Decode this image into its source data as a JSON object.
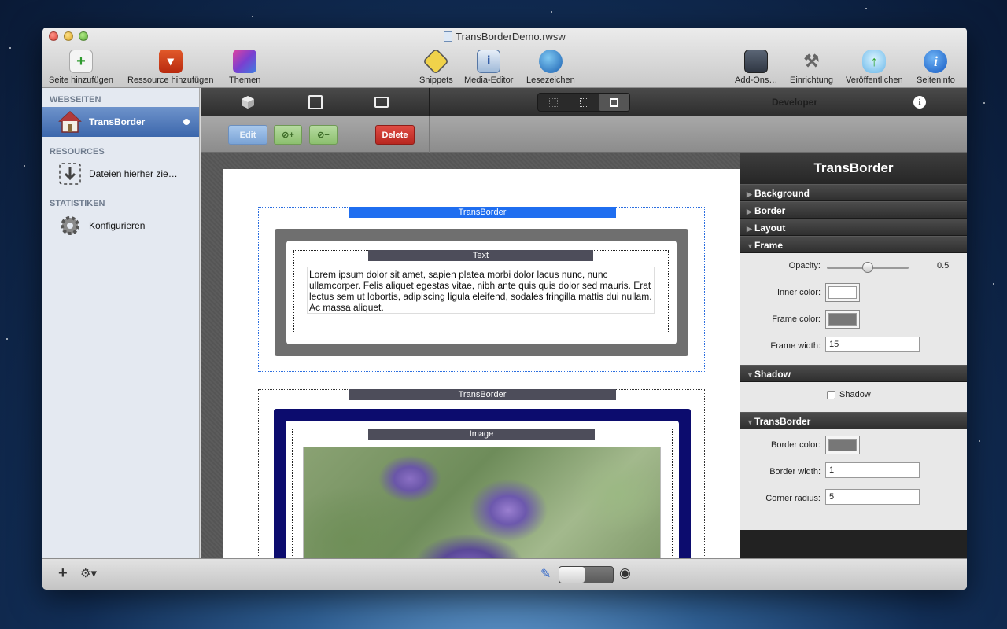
{
  "window": {
    "title": "TransBorderDemo.rwsw"
  },
  "toolbar": {
    "add_page": "Seite hinzufügen",
    "add_resource": "Ressource hinzufügen",
    "themes": "Themen",
    "snippets": "Snippets",
    "media_editor": "Media-Editor",
    "bookmarks": "Lesezeichen",
    "addons": "Add-Ons…",
    "setup": "Einrichtung",
    "publish": "Veröffentlichen",
    "page_info": "Seiteninfo"
  },
  "sidebar": {
    "section_pages": "WEBSEITEN",
    "page_item": "TransBorder",
    "section_resources": "RESOURCES",
    "resource_item": "Dateien hierher zie…",
    "section_stats": "STATISTIKEN",
    "stats_item": "Konfigurieren"
  },
  "editor": {
    "edit_label": "Edit",
    "delete_label": "Delete",
    "stack1_tag": "TransBorder",
    "text_tag": "Text",
    "body_text": "Lorem ipsum dolor sit amet, sapien platea morbi dolor lacus nunc, nunc ullamcorper. Felis aliquet egestas vitae, nibh ante quis quis dolor sed mauris. Erat lectus sem ut lobortis, adipiscing ligula eleifend, sodales fringilla mattis dui nullam. Ac massa aliquet.",
    "stack2_tag": "TransBorder",
    "image_tag": "Image"
  },
  "inspector": {
    "tab_label": "Developer",
    "title": "TransBorder",
    "sections": {
      "background": "Background",
      "border": "Border",
      "layout": "Layout",
      "frame": "Frame",
      "shadow": "Shadow",
      "transborder": "TransBorder"
    },
    "opacity_label": "Opacity:",
    "opacity_value": "0.5",
    "opacity": 0.5,
    "inner_color_label": "Inner color:",
    "frame_color_label": "Frame color:",
    "frame_width_label": "Frame width:",
    "frame_width_value": "15",
    "shadow_checkbox_label": "Shadow",
    "border_color_label": "Border color:",
    "border_width_label": "Border width:",
    "border_width_value": "1",
    "corner_radius_label": "Corner radius:",
    "corner_radius_value": "5"
  },
  "colors": {
    "inner_color": "#ffffff",
    "frame_color": "#777777",
    "border_color": "#777777",
    "selection_blue": "#1f6ef0",
    "navy_border": "#0c0c6e",
    "delete_red": "#c8302a"
  }
}
